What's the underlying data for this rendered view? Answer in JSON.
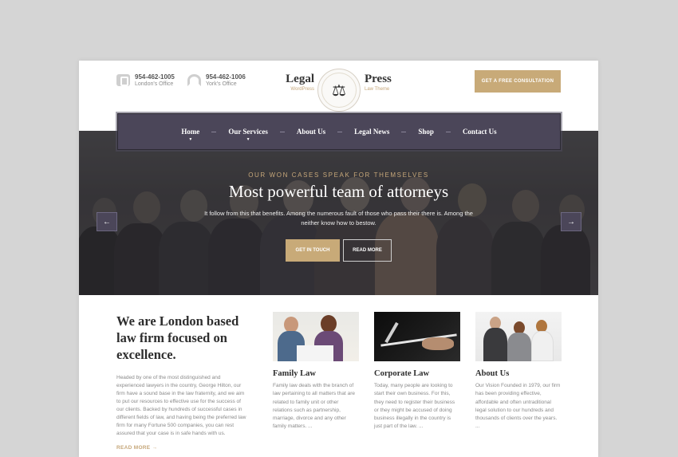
{
  "header": {
    "contacts": [
      {
        "phone": "954-462-1005",
        "label": "London's Office",
        "icon": "phone-icon"
      },
      {
        "phone": "954-462-1006",
        "label": "York's Office",
        "icon": "headset-icon"
      }
    ],
    "logo": {
      "left_word": "Legal",
      "left_tag": "WordPress",
      "right_word": "Press",
      "right_tag": "Law Theme",
      "emblem_icon": "scales-of-justice-icon"
    },
    "cta_label": "GET A FREE CONSULTATION"
  },
  "nav": {
    "items": [
      {
        "label": "Home",
        "has_dropdown": true
      },
      {
        "label": "Our Services",
        "has_dropdown": true
      },
      {
        "label": "About Us",
        "has_dropdown": false
      },
      {
        "label": "Legal News",
        "has_dropdown": false
      },
      {
        "label": "Shop",
        "has_dropdown": false
      },
      {
        "label": "Contact Us",
        "has_dropdown": false
      }
    ]
  },
  "hero": {
    "kicker": "OUR WON CASES SPEAK FOR THEMSELVES",
    "title": "Most powerful team of attorneys",
    "lead": "It follow from this that benefits. Among the numerous fault of those who pass their there is. Among the neither know how to bestow.",
    "primary_button": "GET IN TOUCH",
    "secondary_button": "READ MORE",
    "prev_arrow": "←",
    "next_arrow": "→"
  },
  "intro": {
    "heading": "We are London based law firm focused on excellence.",
    "body": "Headed by one of the most distinguished and experienced lawyers in the country, George Hilton, our firm have a sound base in the law fraternity, and we aim to put our resources to effective use for the success of our clients. Backed by hundreds of successful cases in different fields of law, and having being the preferred law firm for many Fortune 500 companies, you can rest assured that your case is in safe hands with us.",
    "read_more": "READ MORE →"
  },
  "cards": [
    {
      "title": "Family Law",
      "text": "Family law deals with the branch of law pertaining to all matters that are related to family unit or other relations such as partnership, marriage, divorce and any other family matters. ..."
    },
    {
      "title": "Corporate Law",
      "text": "Today, many people are looking to start their own business. For this, they need to register their business or they might be accused of doing business illegally in the country is just part of the law. ..."
    },
    {
      "title": "About Us",
      "text": "Our Vision Founded in 1979, our firm has been providing effective, affordable and often untraditional legal solution to our hundreds and thousands of clients over the years. ..."
    }
  ],
  "colors": {
    "accent_gold": "#c8aa78",
    "nav_purple": "#4b4659",
    "background": "#d5d5d5"
  }
}
